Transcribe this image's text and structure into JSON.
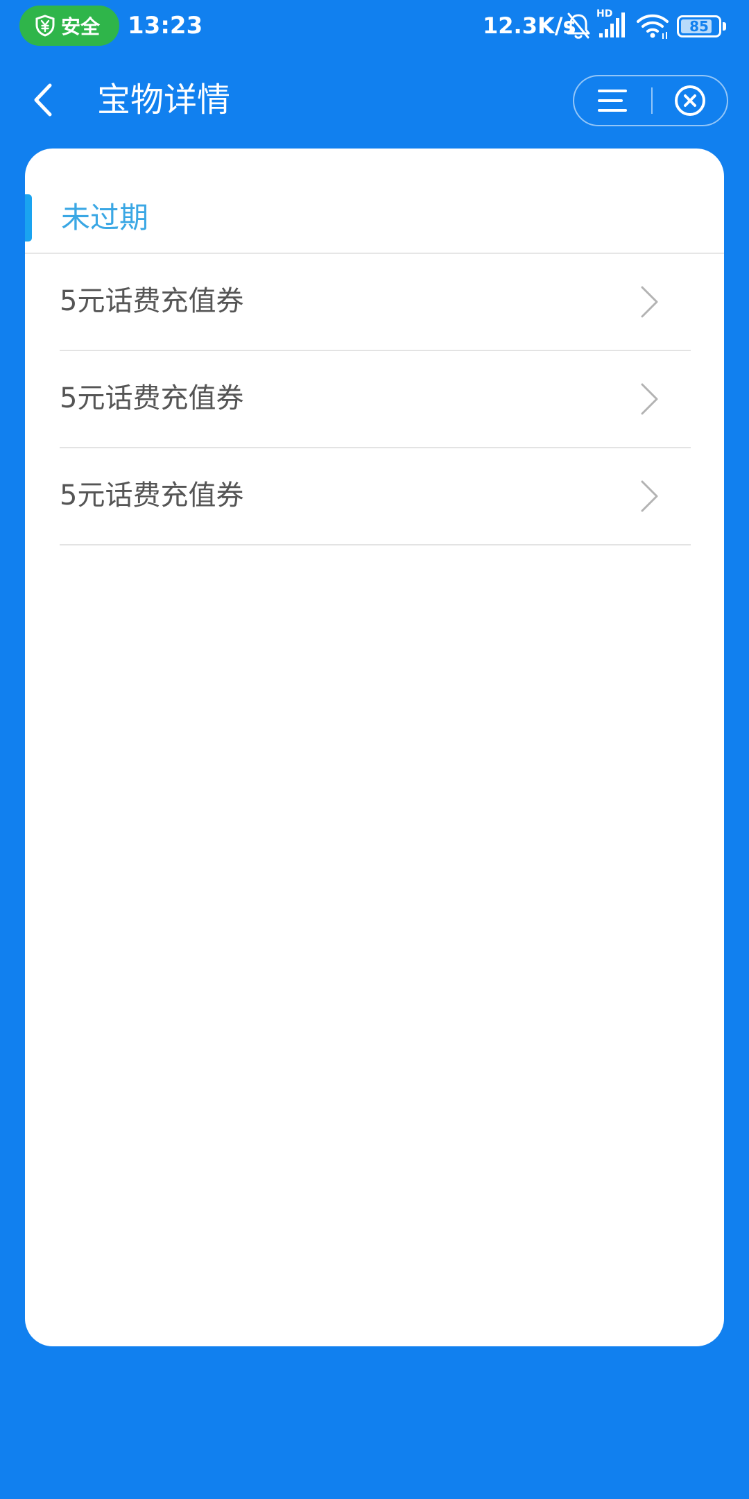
{
  "status_bar": {
    "safety_label": "安全",
    "time": "13:23",
    "network_speed": "12.3K/s",
    "signal_badge": "HD",
    "battery_percent": "85",
    "battery_level": 0.85,
    "icons": [
      "shield-yen-icon",
      "bell-off-icon",
      "signal-icon",
      "wifi-icon",
      "battery-icon"
    ]
  },
  "header": {
    "title": "宝物详情",
    "icons": [
      "back-arrow-icon",
      "menu-icon",
      "close-circle-icon"
    ]
  },
  "section": {
    "title": "未过期"
  },
  "coupons": [
    {
      "label": "5元话费充值券"
    },
    {
      "label": "5元话费充值券"
    },
    {
      "label": "5元话费充值券"
    }
  ],
  "colors": {
    "background": "#1180ef",
    "card": "#ffffff",
    "safety_pill": "#2fb54a",
    "section_title": "#3aa7e4",
    "section_indicator": "#1aa3f0",
    "item_text": "#555555"
  }
}
